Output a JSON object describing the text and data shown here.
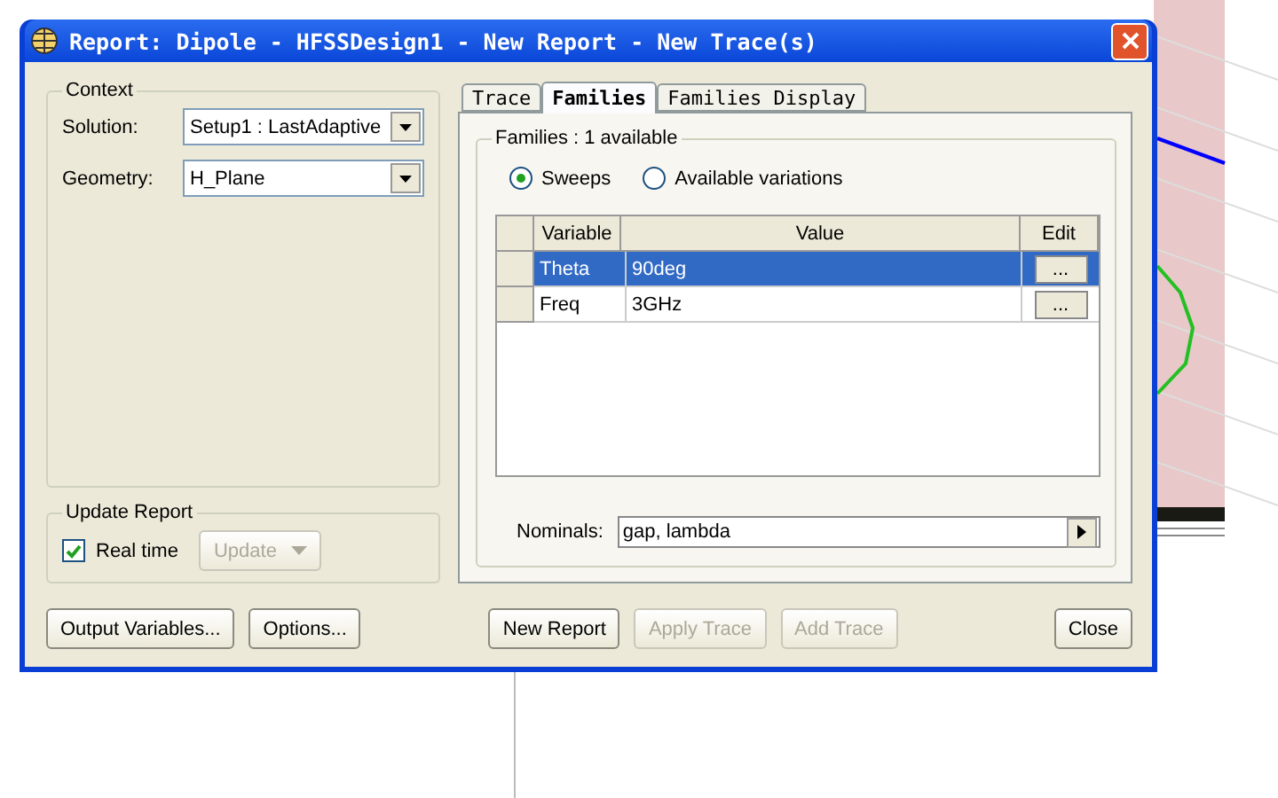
{
  "window": {
    "title": "Report: Dipole - HFSSDesign1 - New Report - New Trace(s)"
  },
  "context": {
    "title": "Context",
    "fields": [
      {
        "label": "Solution:",
        "value": "Setup1 : LastAdaptive"
      },
      {
        "label": "Geometry:",
        "value": "H_Plane"
      }
    ]
  },
  "update_report": {
    "title": "Update Report",
    "real_time": {
      "label": "Real time",
      "checked": true
    },
    "update_button": {
      "label": "Update",
      "disabled": true
    }
  },
  "tabs": [
    {
      "label": "Trace",
      "selected": false
    },
    {
      "label": "Families",
      "selected": true
    },
    {
      "label": "Families Display",
      "selected": false
    }
  ],
  "families": {
    "title": "Families : 1 available",
    "radios": [
      {
        "label": "Sweeps",
        "selected": true
      },
      {
        "label": "Available variations",
        "selected": false
      }
    ],
    "columns": [
      "Variable",
      "Value",
      "Edit"
    ],
    "rows": [
      {
        "variable": "Theta",
        "value": "90deg",
        "edit": "...",
        "selected": true
      },
      {
        "variable": "Freq",
        "value": "3GHz",
        "edit": "...",
        "selected": false
      }
    ],
    "nominals": {
      "label": "Nominals:",
      "value": "gap, lambda"
    }
  },
  "buttons_left": [
    {
      "label": "Output Variables...",
      "disabled": false
    },
    {
      "label": "Options...",
      "disabled": false
    }
  ],
  "buttons_right": [
    {
      "label": "New Report",
      "disabled": false
    },
    {
      "label": "Apply Trace",
      "disabled": true
    },
    {
      "label": "Add Trace",
      "disabled": true
    }
  ],
  "close_button": {
    "label": "Close",
    "disabled": false
  }
}
